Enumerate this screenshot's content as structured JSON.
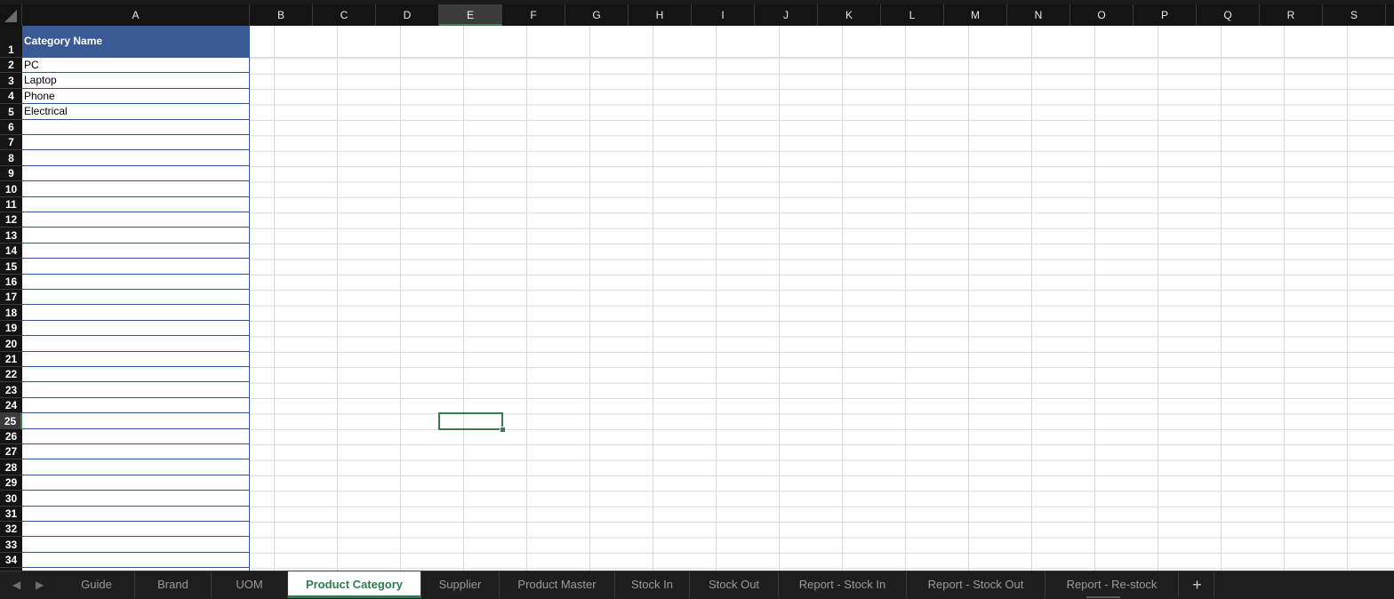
{
  "app": {
    "sheet_tabs": [
      {
        "label": "Guide",
        "active": false
      },
      {
        "label": "Brand",
        "active": false
      },
      {
        "label": "UOM",
        "active": false
      },
      {
        "label": "Product Category",
        "active": true
      },
      {
        "label": "Supplier",
        "active": false
      },
      {
        "label": "Product Master",
        "active": false
      },
      {
        "label": "Stock In",
        "active": false
      },
      {
        "label": "Stock Out",
        "active": false
      },
      {
        "label": "Report - Stock In",
        "active": false
      },
      {
        "label": "Report - Stock Out",
        "active": false
      },
      {
        "label": "Report - Re-stock",
        "active": false
      }
    ],
    "add_tab_label": "+",
    "nav_prev_icon": "◀",
    "nav_next_icon": "▶"
  },
  "grid": {
    "columns": [
      "A",
      "B",
      "C",
      "D",
      "E",
      "F",
      "G",
      "H",
      "I",
      "J",
      "K",
      "L",
      "M",
      "N",
      "O",
      "P",
      "Q",
      "R",
      "S"
    ],
    "rows": [
      "1",
      "2",
      "3",
      "4",
      "5",
      "6",
      "7",
      "8",
      "9",
      "10",
      "11",
      "12",
      "13",
      "14",
      "15",
      "16",
      "17",
      "18",
      "19",
      "20",
      "21",
      "22",
      "23",
      "24",
      "25",
      "26",
      "27",
      "28",
      "29",
      "30",
      "31",
      "32",
      "33",
      "34"
    ],
    "selected_column": "E",
    "selected_row": "25",
    "table": {
      "header": "Category Name",
      "values": [
        "PC",
        "Laptop",
        "Phone",
        "Electrical"
      ]
    }
  },
  "colors": {
    "header_fill": "#3a5a96",
    "table_border": "#2f5597",
    "selection": "#3c7a52",
    "active_tab_text": "#2e7d4f"
  }
}
